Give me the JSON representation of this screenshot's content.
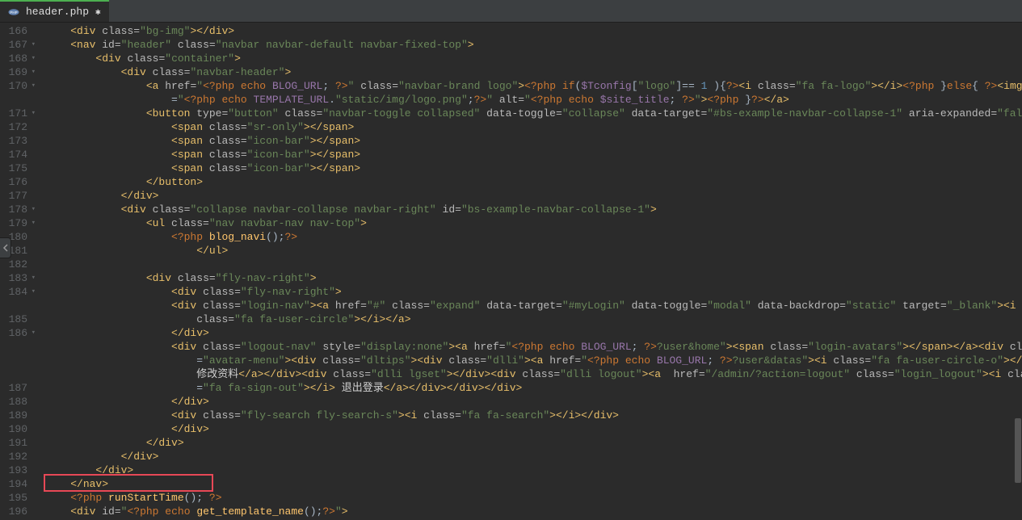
{
  "tab": {
    "filename": "header.php",
    "modified_glyph": "✱",
    "close_glyph": ""
  },
  "gutter": {
    "start": 166,
    "end": 195,
    "fold_lines": [
      167,
      168,
      169,
      170,
      171,
      178,
      179,
      183,
      184,
      186
    ]
  },
  "code_lines": [
    {
      "indent": 1,
      "html": "<span class='tag'>&lt;div</span> <span class='attr'>class=</span><span class='str'>\"bg-img\"</span><span class='tag'>&gt;&lt;/div&gt;</span>"
    },
    {
      "indent": 1,
      "html": "<span class='tag'>&lt;nav</span> <span class='attr'>id=</span><span class='str'>\"header\"</span> <span class='attr'>class=</span><span class='str'>\"navbar navbar-default navbar-fixed-top\"</span><span class='tag'>&gt;</span>"
    },
    {
      "indent": 2,
      "html": "<span class='tag'>&lt;div</span> <span class='attr'>class=</span><span class='str'>\"container\"</span><span class='tag'>&gt;</span>"
    },
    {
      "indent": 3,
      "html": "<span class='tag'>&lt;div</span> <span class='attr'>class=</span><span class='str'>\"navbar-header\"</span><span class='tag'>&gt;</span>"
    },
    {
      "indent": 4,
      "html": "<span class='tag'>&lt;a</span> <span class='attr'>href=</span><span class='str'>\"</span><span class='php'>&lt;?php</span> <span class='kw'>echo</span> <span class='var'>BLOG_URL</span>; <span class='php'>?&gt;</span><span class='str'>\"</span> <span class='attr'>class=</span><span class='str'>\"navbar-brand logo\"</span><span class='tag'>&gt;</span><span class='php'>&lt;?php</span> <span class='kw'>if</span>(<span class='var'>$Tconfig</span>[<span class='str'>\"logo\"</span>]<span class='op'>==</span> <span class='num'>1</span> ){<span class='php'>?&gt;</span><span class='tag'>&lt;i</span> <span class='attr'>class=</span><span class='str'>\"fa fa-logo\"</span><span class='tag'>&gt;&lt;/i&gt;</span><span class='php'>&lt;?php</span> }<span class='kw'>else</span>{ <span class='php'>?&gt;</span><span class='tag'>&lt;img</span> <span class='attr'>src</span>"
    },
    {
      "indent": 5,
      "html": "<span class='op'>=</span><span class='str'>\"</span><span class='php'>&lt;?php</span> <span class='kw'>echo</span> <span class='var'>TEMPLATE_URL</span>.<span class='str'>\"static/img/logo.png\"</span>;<span class='php'>?&gt;</span><span class='str'>\"</span> <span class='attr'>alt=</span><span class='str'>\"</span><span class='php'>&lt;?php</span> <span class='kw'>echo</span> <span class='var'>$site_title</span>; <span class='php'>?&gt;</span><span class='str'>\"</span><span class='tag'>&gt;</span><span class='php'>&lt;?php</span> }<span class='php'>?&gt;</span><span class='tag'>&lt;/a&gt;</span>"
    },
    {
      "indent": 4,
      "html": "<span class='tag'>&lt;button</span> <span class='attr'>type=</span><span class='str'>\"button\"</span> <span class='attr'>class=</span><span class='str'>\"navbar-toggle collapsed\"</span> <span class='attr'>data-toggle=</span><span class='str'>\"collapse\"</span> <span class='attr'>data-target=</span><span class='str'>\"#bs-example-navbar-collapse-1\"</span> <span class='attr'>aria-expanded=</span><span class='str'>\"false\"</span><span class='tag'>&gt;</span>"
    },
    {
      "indent": 5,
      "html": "<span class='tag'>&lt;span</span> <span class='attr'>class=</span><span class='str'>\"sr-only\"</span><span class='tag'>&gt;&lt;/span&gt;</span>"
    },
    {
      "indent": 5,
      "html": "<span class='tag'>&lt;span</span> <span class='attr'>class=</span><span class='str'>\"icon-bar\"</span><span class='tag'>&gt;&lt;/span&gt;</span>"
    },
    {
      "indent": 5,
      "html": "<span class='tag'>&lt;span</span> <span class='attr'>class=</span><span class='str'>\"icon-bar\"</span><span class='tag'>&gt;&lt;/span&gt;</span>"
    },
    {
      "indent": 5,
      "html": "<span class='tag'>&lt;span</span> <span class='attr'>class=</span><span class='str'>\"icon-bar\"</span><span class='tag'>&gt;&lt;/span&gt;</span>"
    },
    {
      "indent": 4,
      "html": "<span class='tag'>&lt;/button&gt;</span>"
    },
    {
      "indent": 3,
      "html": "<span class='tag'>&lt;/div&gt;</span>"
    },
    {
      "indent": 3,
      "html": "<span class='tag'>&lt;div</span> <span class='attr'>class=</span><span class='str'>\"collapse navbar-collapse navbar-right\"</span> <span class='attr'>id=</span><span class='str'>\"bs-example-navbar-collapse-1\"</span><span class='tag'>&gt;</span>"
    },
    {
      "indent": 4,
      "html": "<span class='tag'>&lt;ul</span> <span class='attr'>class=</span><span class='str'>\"nav navbar-nav nav-top\"</span><span class='tag'>&gt;</span>"
    },
    {
      "indent": 5,
      "html": "<span class='php'>&lt;?php</span> <span class='fn'>blog_navi</span>();<span class='php'>?&gt;</span>"
    },
    {
      "indent": 6,
      "html": "<span class='tag'>&lt;/ul&gt;</span>"
    },
    {
      "indent": 0,
      "html": ""
    },
    {
      "indent": 4,
      "html": "<span class='tag'>&lt;div</span> <span class='attr'>class=</span><span class='str'>\"fly-nav-right\"</span><span class='tag'>&gt;</span>"
    },
    {
      "indent": 5,
      "html": "<span class='tag'>&lt;div</span> <span class='attr'>class=</span><span class='str'>\"fly-nav-right\"</span><span class='tag'>&gt;</span>"
    },
    {
      "indent": 5,
      "html": "<span class='tag'>&lt;div</span> <span class='attr'>class=</span><span class='str'>\"login-nav\"</span><span class='tag'>&gt;&lt;a</span> <span class='attr'>href=</span><span class='str'>\"#\"</span> <span class='attr'>class=</span><span class='str'>\"expand\"</span> <span class='attr'>data-target=</span><span class='str'>\"#myLogin\"</span> <span class='attr'>data-toggle=</span><span class='str'>\"modal\"</span> <span class='attr'>data-backdrop=</span><span class='str'>\"static\"</span> <span class='attr'>target=</span><span class='str'>\"_blank\"</span><span class='tag'>&gt;&lt;i</span>"
    },
    {
      "indent": 6,
      "html": "<span class='attr'>class=</span><span class='str'>\"fa fa-user-circle\"</span><span class='tag'>&gt;&lt;/i&gt;&lt;/a&gt;</span>"
    },
    {
      "indent": 5,
      "html": "<span class='tag'>&lt;/div&gt;</span>"
    },
    {
      "indent": 5,
      "html": "<span class='tag'>&lt;div</span> <span class='attr'>class=</span><span class='str'>\"logout-nav\"</span> <span class='attr'>style=</span><span class='str'>\"display:none\"</span><span class='tag'>&gt;&lt;a</span> <span class='attr'>href=</span><span class='str'>\"</span><span class='php'>&lt;?php</span> <span class='kw'>echo</span> <span class='var'>BLOG_URL</span>; <span class='php'>?&gt;</span><span class='str'>?user&amp;home\"</span><span class='tag'>&gt;&lt;span</span> <span class='attr'>class=</span><span class='str'>\"login-avatars\"</span><span class='tag'>&gt;&lt;/span&gt;&lt;/a&gt;&lt;div</span> <span class='attr'>class</span>"
    },
    {
      "indent": 6,
      "html": "<span class='op'>=</span><span class='str'>\"avatar-menu\"</span><span class='tag'>&gt;&lt;div</span> <span class='attr'>class=</span><span class='str'>\"dltips\"</span><span class='tag'>&gt;&lt;div</span> <span class='attr'>class=</span><span class='str'>\"dlli\"</span><span class='tag'>&gt;&lt;a</span> <span class='attr'>href=</span><span class='str'>\"</span><span class='php'>&lt;?php</span> <span class='kw'>echo</span> <span class='var'>BLOG_URL</span>; <span class='php'>?&gt;</span><span class='str'>?user&amp;datas\"</span><span class='tag'>&gt;&lt;i</span> <span class='attr'>class=</span><span class='str'>\"fa fa-user-circle-o\"</span><span class='tag'>&gt;&lt;/i&gt;</span>"
    },
    {
      "indent": 6,
      "html": "<span class='cn'>修改资料</span><span class='tag'>&lt;/a&gt;&lt;/div&gt;&lt;div</span> <span class='attr'>class=</span><span class='str'>\"dlli lgset\"</span><span class='tag'>&gt;&lt;/div&gt;&lt;div</span> <span class='attr'>class=</span><span class='str'>\"dlli logout\"</span><span class='tag'>&gt;&lt;a</span>  <span class='attr'>href=</span><span class='str'>\"/admin/?action=logout\"</span> <span class='attr'>class=</span><span class='str'>\"login_logout\"</span><span class='tag'>&gt;&lt;i</span> <span class='attr'>class</span>"
    },
    {
      "indent": 6,
      "html": "<span class='op'>=</span><span class='str'>\"fa fa-sign-out\"</span><span class='tag'>&gt;&lt;/i&gt;</span> <span class='cn'>退出登录</span><span class='tag'>&lt;/a&gt;&lt;/div&gt;&lt;/div&gt;&lt;/div&gt;</span>"
    },
    {
      "indent": 5,
      "html": "<span class='tag'>&lt;/div&gt;</span>"
    },
    {
      "indent": 5,
      "html": "<span class='tag'>&lt;div</span> <span class='attr'>class=</span><span class='str'>\"fly-search fly-search-s\"</span><span class='tag'>&gt;&lt;i</span> <span class='attr'>class=</span><span class='str'>\"fa fa-search\"</span><span class='tag'>&gt;&lt;/i&gt;&lt;/div&gt;</span>"
    },
    {
      "indent": 5,
      "html": "<span class='tag'>&lt;/div&gt;</span>"
    },
    {
      "indent": 4,
      "html": "<span class='tag'>&lt;/div&gt;</span>"
    },
    {
      "indent": 3,
      "html": "<span class='tag'>&lt;/div&gt;</span>"
    },
    {
      "indent": 2,
      "html": "<span class='tag'>&lt;/div&gt;</span>"
    },
    {
      "indent": 1,
      "html": "<span class='tag'>&lt;/nav&gt;</span>"
    },
    {
      "indent": 1,
      "html": "<span class='php'>&lt;?php</span> <span class='fn'>runStartTime</span>(); <span class='php'>?&gt;</span>"
    },
    {
      "indent": 1,
      "html": "<span class='tag'>&lt;div</span> <span class='attr'>id=</span><span class='str'>\"</span><span class='php'>&lt;?php</span> <span class='kw'>echo</span> <span class='fn'>get_template_name</span>();<span class='php'>?&gt;</span><span class='str'>\"</span><span class='tag'>&gt;</span>"
    }
  ],
  "wrapped_continuations": {
    "170": 1,
    "184": 1,
    "186": 3
  },
  "highlight": {
    "line": 194
  }
}
